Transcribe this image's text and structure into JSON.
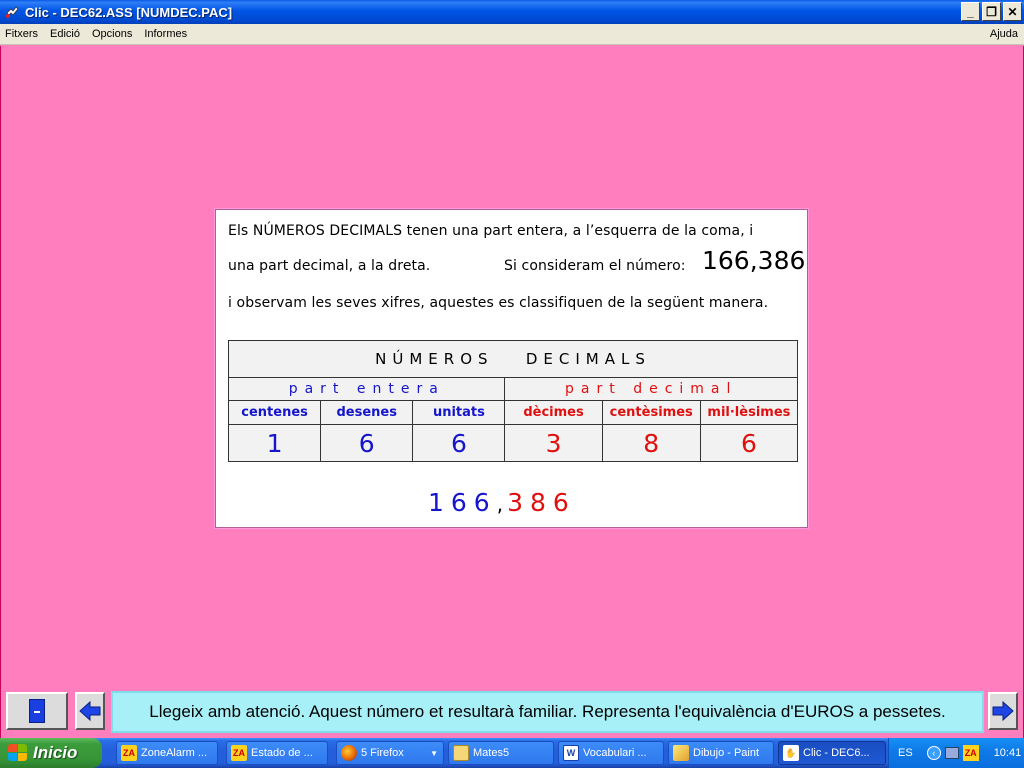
{
  "window": {
    "title": "Clic - DEC62.ASS [NUMDEC.PAC]",
    "min": "_",
    "restore": "❐",
    "close": "✕"
  },
  "menu": {
    "items": [
      "Fitxers",
      "Edició",
      "Opcions",
      "Informes"
    ],
    "help": "Ajuda"
  },
  "panel": {
    "line1": "Els NÚMEROS DECIMALS tenen una part entera, a l’esquerra de la coma, i",
    "line2": "una part decimal, a la dreta.",
    "line2b": "Si consideram el número:",
    "big_number": "166,386",
    "line3": "i observam les seves xifres, aquestes es classifiquen de la següent manera.",
    "table": {
      "header": "NÚMEROS   DECIMALS",
      "part_entera": "part entera",
      "part_decimal": "part decimal",
      "labels": [
        "centenes",
        "desenes",
        "unitats",
        "dècimes",
        "centèsimes",
        "mil·lèsimes"
      ],
      "digits": [
        "1",
        "6",
        "6",
        "3",
        "8",
        "6"
      ]
    },
    "bottom_int": "166",
    "bottom_comma": ",",
    "bottom_dec": "386"
  },
  "message": "Llegeix amb atenció. Aquest número et resultarà familiar. Representa l'equivalència d'EUROS a pessetes.",
  "taskbar": {
    "start_label": "Inicio",
    "items": [
      {
        "label": "ZoneAlarm ...",
        "icon": "zonealarm-icon"
      },
      {
        "label": "Estado de ...",
        "icon": "zonealarm-icon"
      },
      {
        "label": "5 Firefox",
        "icon": "firefox-icon"
      },
      {
        "label": "Mates5",
        "icon": "folder-icon"
      },
      {
        "label": "Vocabulari ...",
        "icon": "word-icon"
      },
      {
        "label": "Dibujo - Paint",
        "icon": "paint-icon"
      },
      {
        "label": "Clic - DEC6...",
        "icon": "clic-icon"
      }
    ],
    "tray": {
      "lang": "ES",
      "time": "10:41"
    }
  },
  "colors": {
    "stage": "#ff7ebd",
    "integer_part": "#1515cc",
    "decimal_part": "#e01010",
    "message_bg": "#a8f0f8"
  }
}
